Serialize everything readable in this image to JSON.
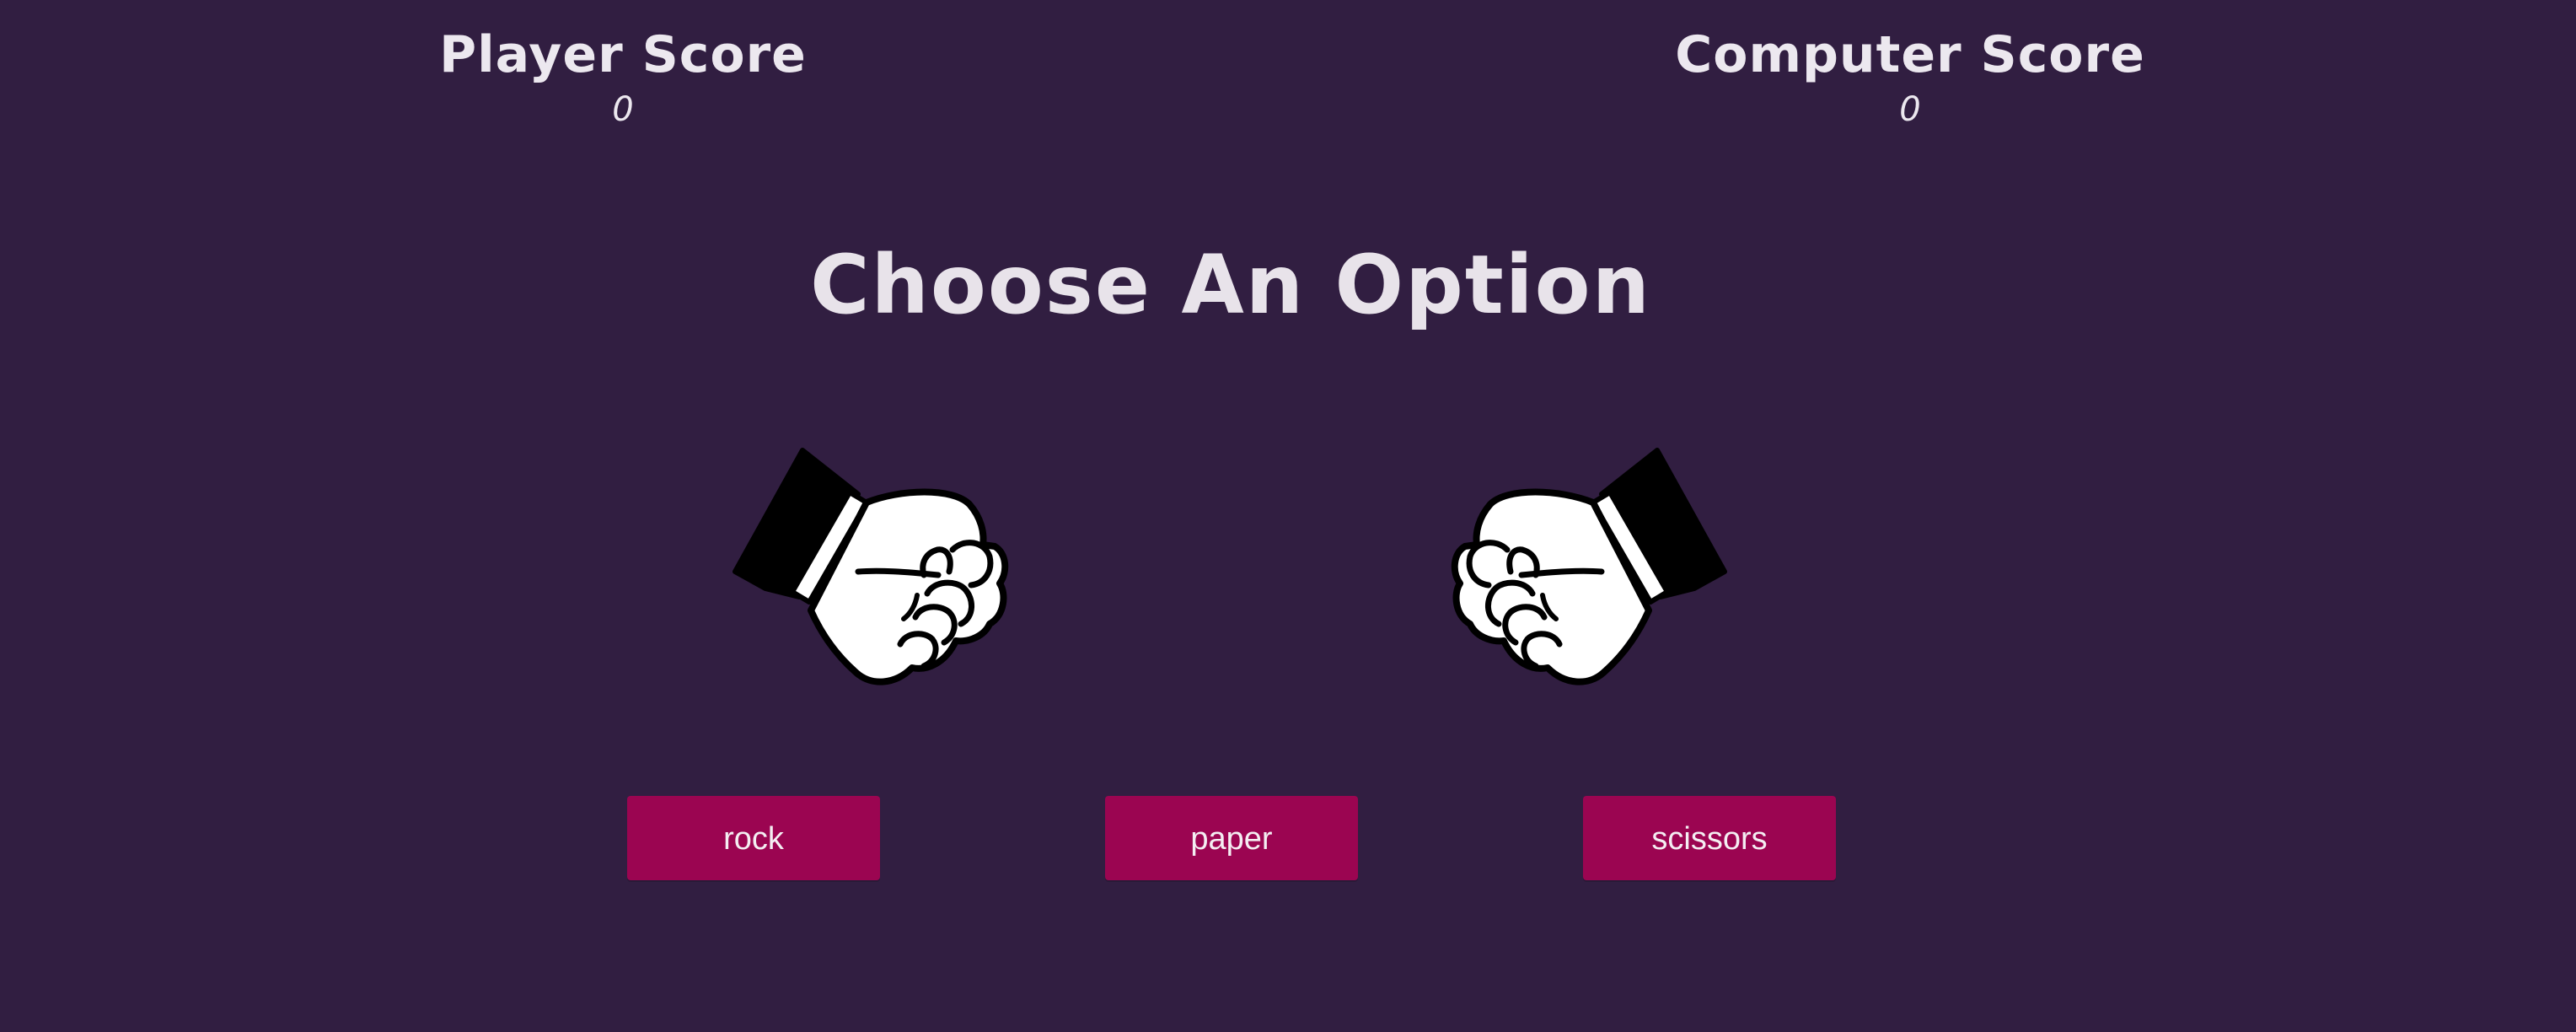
{
  "scores": {
    "player_label": "Player Score",
    "player_value": "0",
    "computer_label": "Computer Score",
    "computer_value": "0"
  },
  "heading": "Choose An Option",
  "hands": {
    "player_icon": "rock-fist-icon",
    "computer_icon": "rock-fist-icon"
  },
  "options": {
    "rock": "rock",
    "paper": "paper",
    "scissors": "scissors"
  },
  "colors": {
    "background": "#311e41",
    "button": "#9b0551",
    "text": "#e8e3ea"
  }
}
